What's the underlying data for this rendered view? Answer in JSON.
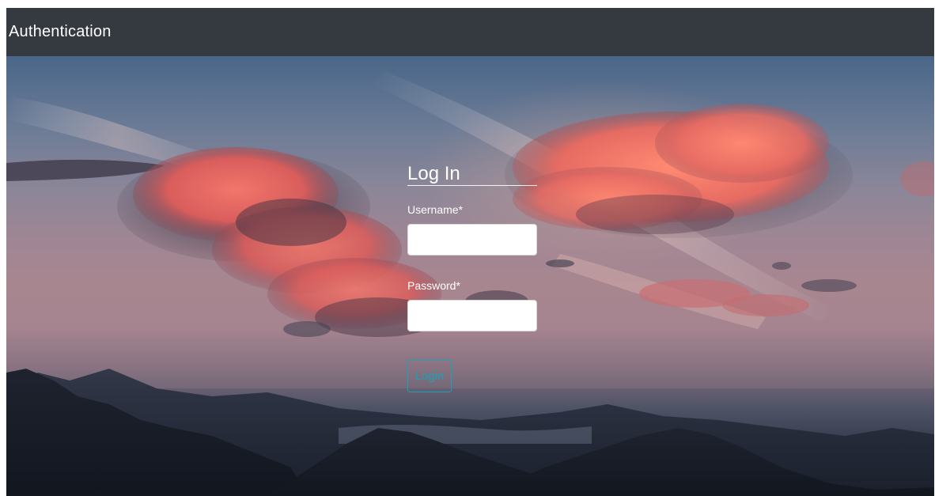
{
  "app": {
    "title": "Authentication"
  },
  "login": {
    "heading": "Log In",
    "username_label": "Username*",
    "username_value": "",
    "password_label": "Password*",
    "password_value": "",
    "submit_label": "Login"
  },
  "theme": {
    "topbar_bg": "#343a40",
    "accent": "#17a2b8",
    "text_light": "#ffffff"
  }
}
